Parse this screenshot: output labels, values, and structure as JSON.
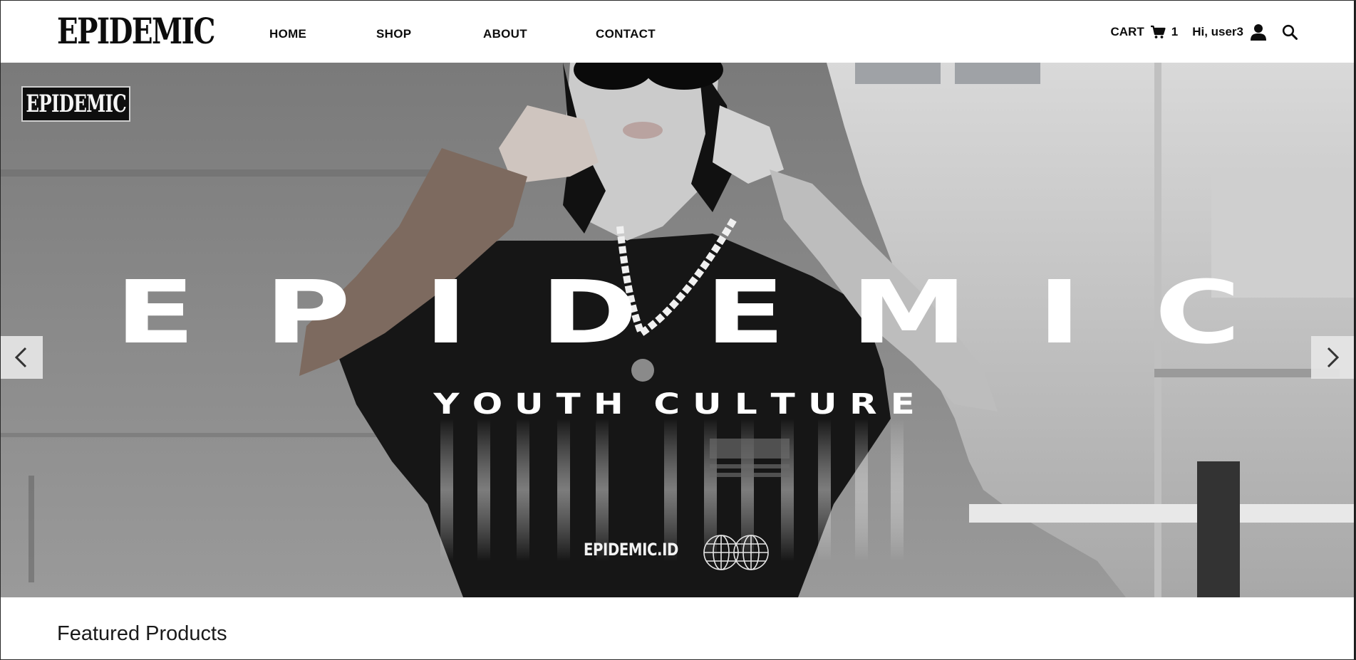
{
  "brand": {
    "logo_text": "EPIDEMIC"
  },
  "nav": {
    "links": [
      {
        "label": "HOME"
      },
      {
        "label": "SHOP"
      },
      {
        "label": "ABOUT"
      },
      {
        "label": "CONTACT"
      }
    ]
  },
  "account": {
    "cart_label": "CART",
    "cart_count": "1",
    "greeting": "Hi, user3",
    "icons": {
      "cart": "cart-icon",
      "user": "user-icon",
      "search": "search-icon"
    }
  },
  "hero": {
    "badge_text": "EPIDEMIC",
    "title_letters": [
      "E",
      "P",
      "I",
      "D",
      "E",
      "M",
      "I",
      "C"
    ],
    "subtitle_letters": [
      "Y",
      "O",
      "U",
      "T",
      "H",
      " ",
      "C",
      "U",
      "L",
      "T",
      "U",
      "R",
      "E"
    ],
    "site_text": "EPIDEMIC.ID",
    "controls": {
      "prev": "chevron-left-icon",
      "next": "chevron-right-icon"
    }
  },
  "featured": {
    "heading": "Featured Products"
  },
  "colors": {
    "text": "#0d0d0d",
    "background": "#ffffff",
    "hero_overlay": "#1a1a1a"
  }
}
